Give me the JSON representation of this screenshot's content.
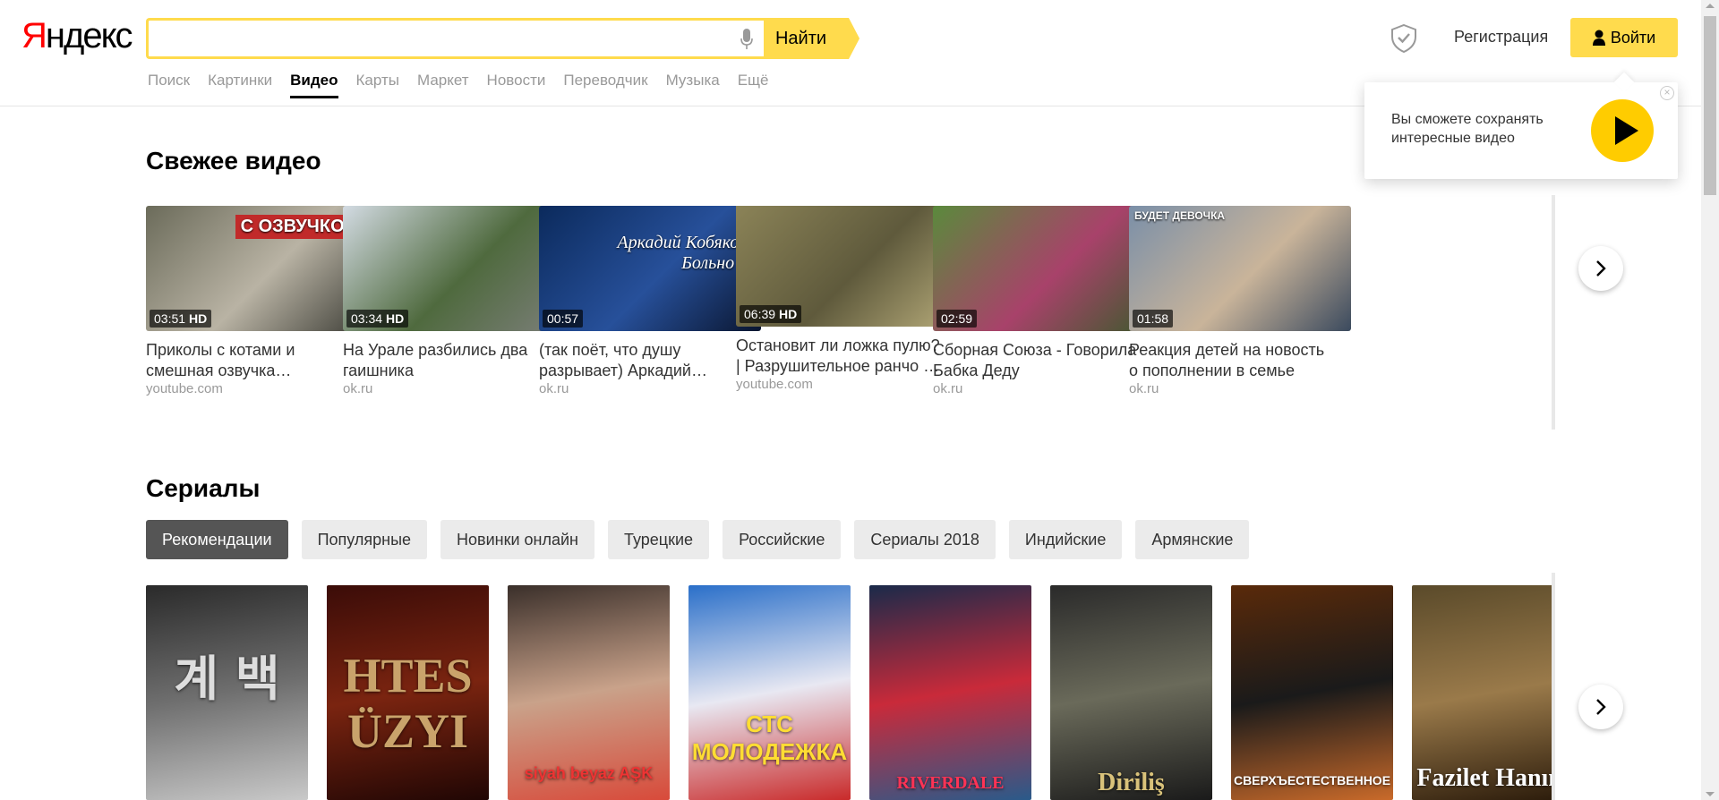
{
  "logo": {
    "first": "Я",
    "rest": "ндекс"
  },
  "search": {
    "value": "",
    "placeholder": "",
    "button_label": "Найти"
  },
  "nav": [
    {
      "label": "Поиск",
      "active": false
    },
    {
      "label": "Картинки",
      "active": false
    },
    {
      "label": "Видео",
      "active": true
    },
    {
      "label": "Карты",
      "active": false
    },
    {
      "label": "Маркет",
      "active": false
    },
    {
      "label": "Новости",
      "active": false
    },
    {
      "label": "Переводчик",
      "active": false
    },
    {
      "label": "Музыка",
      "active": false
    },
    {
      "label": "Ещё",
      "active": false
    }
  ],
  "header": {
    "register_label": "Регистрация",
    "login_label": "Войти"
  },
  "popup": {
    "text": "Вы сможете сохранять интересные видео",
    "close": "×"
  },
  "fresh": {
    "title": "Свежее видео",
    "videos": [
      {
        "title": "Приколы с котами и\nсмешная озвучка…",
        "host": "youtube.com",
        "duration": "03:51",
        "hd": "HD",
        "overlay": "С ОЗВУЧКОЙ",
        "colors": [
          "#6b6b5a",
          "#b9b3a4",
          "#3f3f38"
        ]
      },
      {
        "title": "На Урале разбились два\nгаишника",
        "host": "ok.ru",
        "duration": "03:34",
        "hd": "HD",
        "overlay": "",
        "colors": [
          "#d3dbe3",
          "#4f6a3e",
          "#7c7f7a"
        ]
      },
      {
        "title": "(так поёт, что душу\nразрывает) Аркадий…",
        "host": "ok.ru",
        "duration": "00:57",
        "hd": "",
        "overlay": "Аркадий Кобяков · Больно ка",
        "colors": [
          "#0b2a5c",
          "#27509a",
          "#0a1630"
        ]
      },
      {
        "title": "Остановит ли ложка пулю?\n| Разрушительное ранчо …",
        "host": "youtube.com",
        "duration": "06:39",
        "hd": "HD",
        "overlay": "",
        "colors": [
          "#8c8458",
          "#5f5a3c",
          "#b6ab7a"
        ]
      },
      {
        "title": "Сборная Союза - Говорила\nБабка Деду",
        "host": "ok.ru",
        "duration": "02:59",
        "hd": "",
        "overlay": "",
        "colors": [
          "#5a8a3c",
          "#a8426a",
          "#3c5a2c"
        ]
      },
      {
        "title": "Реакция детей на новость\nо пополнении в семье",
        "host": "ok.ru",
        "duration": "01:58",
        "hd": "",
        "overlay": "БУДЕТ ДЕВОЧКА",
        "colors": [
          "#7a8fa8",
          "#c9b49a",
          "#3b4a5e"
        ]
      }
    ]
  },
  "series": {
    "title": "Сериалы",
    "tabs": [
      {
        "label": "Рекомендации",
        "active": true
      },
      {
        "label": "Популярные",
        "active": false
      },
      {
        "label": "Новинки онлайн",
        "active": false
      },
      {
        "label": "Турецкие",
        "active": false
      },
      {
        "label": "Российские",
        "active": false
      },
      {
        "label": "Сериалы 2018",
        "active": false
      },
      {
        "label": "Индийские",
        "active": false
      },
      {
        "label": "Армянские",
        "active": false
      }
    ],
    "posters": [
      {
        "text": "계 백",
        "colors": [
          "#2a2a2a",
          "#6f6f6f",
          "#c9c9c9"
        ],
        "text_color": "#ddd"
      },
      {
        "text": "HTES\nÜZYI",
        "colors": [
          "#3b0c08",
          "#7a2410",
          "#200604"
        ],
        "text_color": "#c9a36b"
      },
      {
        "text": "siyah beyaz AŞK",
        "colors": [
          "#3a2f2a",
          "#c9a28a",
          "#d84a3a"
        ],
        "text_color": "#e33"
      },
      {
        "text": "СТС\nМОЛОДЕЖКА",
        "colors": [
          "#2a6fc9",
          "#e8e8f2",
          "#c92a2a"
        ],
        "text_color": "#ffdd33"
      },
      {
        "text": "RIVERDALE",
        "colors": [
          "#1a2a4a",
          "#c92a3a",
          "#2a5a8a"
        ],
        "text_color": "#ff3355"
      },
      {
        "text": "Diriliş",
        "colors": [
          "#2a2a2a",
          "#6a6a5a",
          "#1a1a1a"
        ],
        "text_color": "#d9c27a"
      },
      {
        "text": "СВЕРХЪЕСТЕСТВЕННОЕ",
        "colors": [
          "#5a2a0a",
          "#1a1a1a",
          "#c96a2a"
        ],
        "text_color": "#fff"
      },
      {
        "text": "Fazilet Hanım",
        "colors": [
          "#5a4a2a",
          "#9a7a4a",
          "#2a1a0a"
        ],
        "text_color": "#fff"
      }
    ]
  }
}
